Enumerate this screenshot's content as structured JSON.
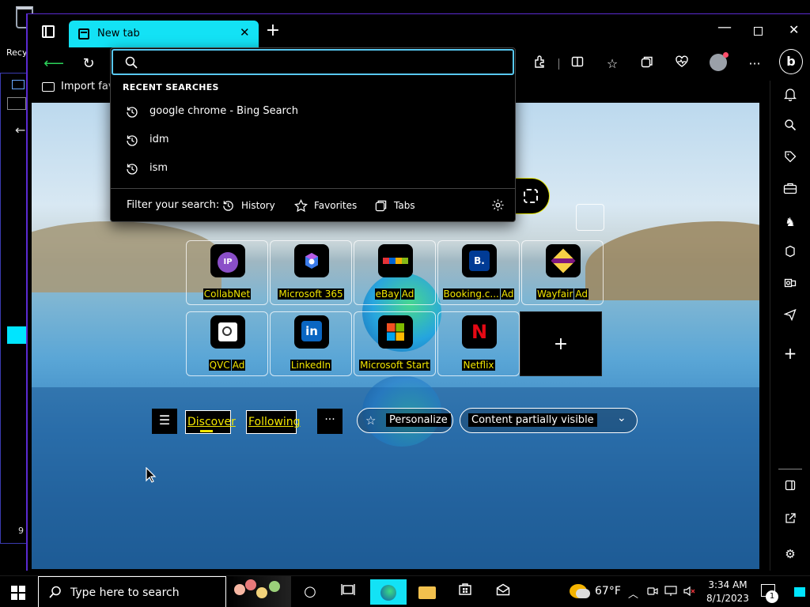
{
  "desktop": {
    "recycle_label": "Recy",
    "behind_number": "9"
  },
  "browser": {
    "tab_title": "New tab",
    "import_favorites": "Import favo"
  },
  "dropdown": {
    "placeholder": "",
    "recent_header": "RECENT SEARCHES",
    "recent": [
      "google chrome - Bing Search",
      "idm",
      "ism"
    ],
    "filter_label": "Filter your search:",
    "filters": {
      "history": "History",
      "favorites": "Favorites",
      "tabs": "Tabs"
    }
  },
  "tiles": [
    {
      "label": "CollabNet",
      "icon_text": "IP",
      "ad": false
    },
    {
      "label": "Microsoft 365",
      "icon_text": "",
      "ad": false
    },
    {
      "label": "eBay",
      "icon_text": "",
      "ad": true
    },
    {
      "label": "Booking.c...",
      "icon_text": "B.",
      "ad": true
    },
    {
      "label": "Wayfair",
      "icon_text": "",
      "ad": true
    },
    {
      "label": "QVC",
      "icon_text": "",
      "ad": true
    },
    {
      "label": "LinkedIn",
      "icon_text": "in",
      "ad": false
    },
    {
      "label": "Microsoft Start",
      "icon_text": "",
      "ad": false
    },
    {
      "label": "Netflix",
      "icon_text": "N",
      "ad": false
    }
  ],
  "ad_label": "Ad",
  "feed": {
    "discover": "Discover",
    "following": "Following",
    "more": "···",
    "personalize": "Personalize",
    "content_visibility": "Content partially visible"
  },
  "taskbar": {
    "search_placeholder": "Type here to search",
    "temperature": "67°F",
    "time": "3:34 AM",
    "date": "8/1/2023",
    "notification_count": "1"
  },
  "colors": {
    "tab_accent": "#13e2f5",
    "label_highlight": "#f2e600",
    "address_focus": "#58c8f0",
    "back_arrow": "#2bd25a"
  }
}
